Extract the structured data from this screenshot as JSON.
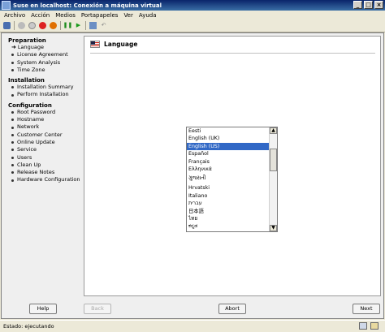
{
  "window": {
    "title": "Suse en localhost: Conexión a máquina virtual"
  },
  "menu": [
    "Archivo",
    "Acción",
    "Medios",
    "Portapapeles",
    "Ver",
    "Ayuda"
  ],
  "toolbar_icons": [
    "ctrl-alt-del-icon",
    "stop-icon",
    "turn-off-icon",
    "shutdown-icon",
    "power-icon",
    "pause-icon",
    "start-icon",
    "snapshot-icon",
    "revert-icon"
  ],
  "sidebar": {
    "sections": [
      {
        "title": "Preparation",
        "items": [
          {
            "label": "Language",
            "current": true
          },
          {
            "label": "License Agreement"
          },
          {
            "label": "System Analysis"
          },
          {
            "label": "Time Zone"
          }
        ]
      },
      {
        "title": "Installation",
        "items": [
          {
            "label": "Installation Summary"
          },
          {
            "label": "Perform Installation"
          }
        ]
      },
      {
        "title": "Configuration",
        "items": [
          {
            "label": "Root Password"
          },
          {
            "label": "Hostname"
          },
          {
            "label": "Network"
          },
          {
            "label": "Customer Center"
          },
          {
            "label": "Online Update"
          },
          {
            "label": "Service"
          },
          {
            "label": "Users"
          },
          {
            "label": "Clean Up"
          },
          {
            "label": "Release Notes"
          },
          {
            "label": "Hardware Configuration"
          }
        ]
      }
    ]
  },
  "panel": {
    "title": "Language"
  },
  "languages": {
    "selected": "English (US)",
    "options": [
      "Eesti",
      "English (UK)",
      "English (US)",
      "Español",
      "Français",
      "Ελληνικά",
      "ગુજરાતી",
      "Hrvatski",
      "Italiano",
      "עברית",
      "日本語",
      "ไทย",
      "ಕನ್ನಡ"
    ]
  },
  "buttons": {
    "help": "Help",
    "back": "Back",
    "abort": "Abort",
    "next": "Next"
  },
  "status": {
    "text": "Estado: ejecutando"
  }
}
